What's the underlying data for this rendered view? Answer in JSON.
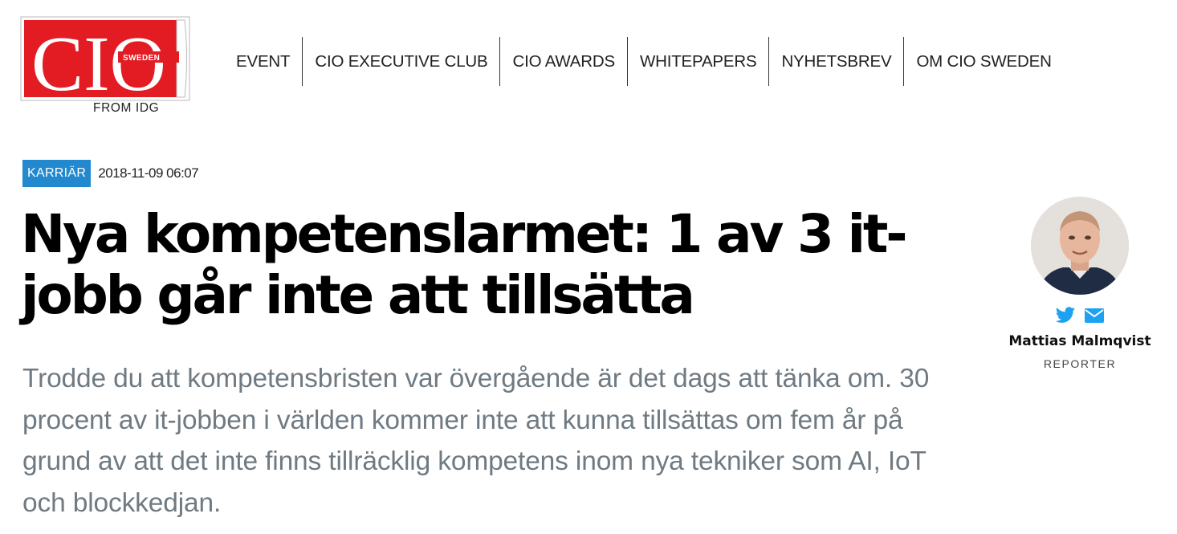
{
  "brand": {
    "logo_text": "CIO",
    "logo_badge": "SWEDEN",
    "logo_sub": "FROM IDG",
    "accent_color": "#e31b23"
  },
  "nav": {
    "items": [
      {
        "label": "EVENT"
      },
      {
        "label": "CIO EXECUTIVE CLUB"
      },
      {
        "label": "CIO AWARDS"
      },
      {
        "label": "WHITEPAPERS"
      },
      {
        "label": "NYHETSBREV"
      },
      {
        "label": "OM CIO SWEDEN"
      }
    ]
  },
  "article": {
    "category": "KARRIÄR",
    "category_color": "#2289cf",
    "date": "2018-11-09 06:07",
    "headline": "Nya kompetenslarmet: 1 av 3 it-jobb går inte att tillsätta",
    "lead": "Trodde du att kompetensbristen var övergående är det dags att tänka om. 30 procent av it-jobben i världen kommer inte att kunna tillsättas om fem år på grund av att det inte finns tillräcklig kompetens inom nya tekniker som AI, IoT och blockkedjan."
  },
  "author": {
    "name": "Mattias Malmqvist",
    "role": "REPORTER",
    "icons": [
      "twitter-icon",
      "mail-icon"
    ],
    "icon_color": "#1da1f2"
  }
}
